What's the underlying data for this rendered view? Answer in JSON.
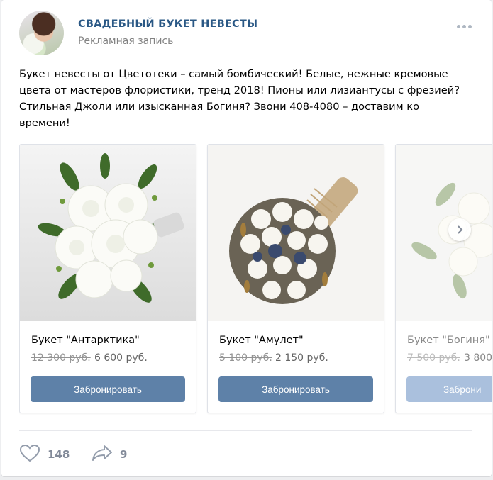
{
  "header": {
    "title": "СВАДЕБНЫЙ БУКЕТ НЕВЕСТЫ",
    "subtitle": "Рекламная запись"
  },
  "post": {
    "lines": [
      "Букет невесты от Цветотеки – самый бомбический! Белые, нежные кремовые",
      "цвета от мастеров флористики, тренд 2018! Пионы или лизиантусы с фрезией?",
      "Стильная Джоли или изысканная Богиня? Звони 408-4080 – доставим ко",
      "времени!"
    ]
  },
  "cards": [
    {
      "name": "Букет \"Антарктика\"",
      "old_price": "12 300 руб.",
      "new_price": "6 600 руб.",
      "button": "Забронировать"
    },
    {
      "name": "Букет \"Амулет\"",
      "old_price": "5 100 руб.",
      "new_price": "2 150 руб.",
      "button": "Забронировать"
    },
    {
      "name": "Букет \"Богиня\"",
      "old_price": "7 500 руб.",
      "new_price": "3 800",
      "button": "Заброни"
    }
  ],
  "footer": {
    "likes": "148",
    "shares": "9"
  },
  "icons": {
    "more": "more-dots-icon",
    "next": "chevron-right-icon",
    "like": "heart-icon",
    "share": "share-arrow-icon"
  },
  "colors": {
    "title": "#2a5885",
    "button": "#5e81a8",
    "muted": "#828282",
    "background": "#edeef0"
  }
}
